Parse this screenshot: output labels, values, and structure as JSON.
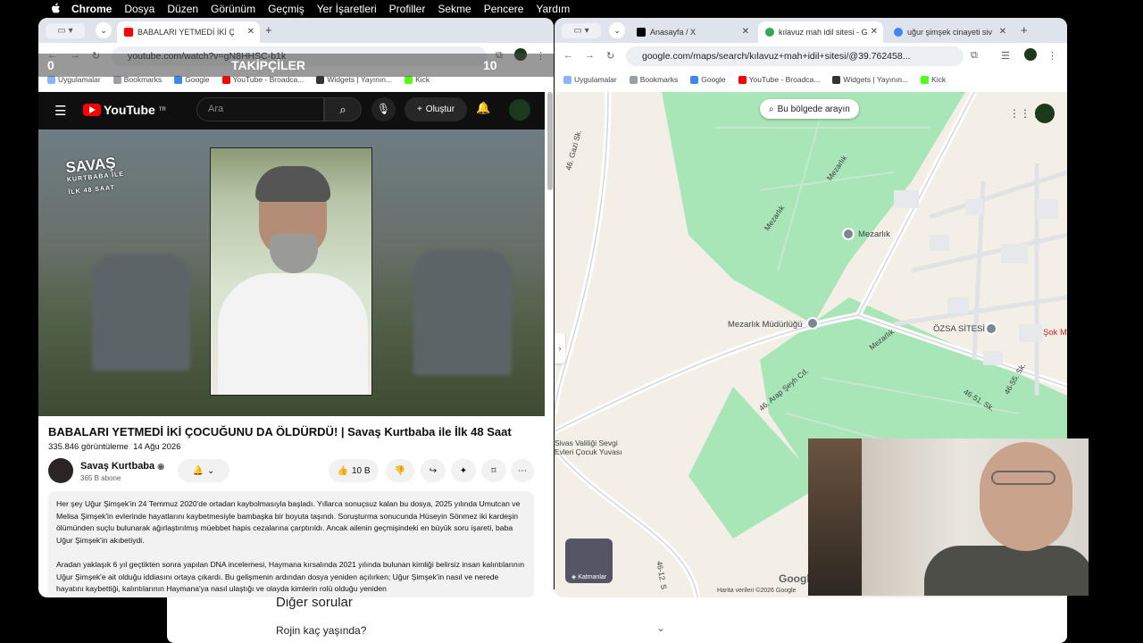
{
  "menubar": {
    "app": "Chrome",
    "items": [
      "Dosya",
      "Düzen",
      "Görünüm",
      "Geçmiş",
      "Yer İşaretleri",
      "Profiller",
      "Sekme",
      "Pencere",
      "Yardım"
    ]
  },
  "left_window": {
    "tab_title": "BABALARI YETMEDİ İKİ ÇOCUĞ",
    "url": "youtube.com/watch?v=gN8HHSC-b1k",
    "bookmarks": [
      "Uygulamalar",
      "Bookmarks",
      "Google",
      "YouTube - Broadca...",
      "Widgets | Yayının...",
      "Kick"
    ],
    "overlay": {
      "left": "0",
      "center": "TAKİPÇİLER",
      "right": "10"
    },
    "youtube": {
      "logo": "YouTube",
      "region": "TR",
      "search_placeholder": "Ara",
      "create": "Oluştur"
    },
    "video": {
      "logo_line1": "SAVAŞ",
      "logo_line2": "KURTBABA İLE",
      "logo_line3": "İLK 48 SAAT"
    },
    "title": "BABALARI YETMEDİ İKİ ÇOCUĞUNU DA ÖLDÜRDÜ! | Savaş Kurtbaba ile İlk 48 Saat",
    "views": "335.846 görüntüleme",
    "date": "14 Ağu 2026",
    "channel": "Savaş Kurtbaba",
    "subscribers": "365 B abone",
    "likes": "10 B",
    "description": [
      "Her şey Uğur Şimşek'in 24 Temmuz 2020'de ortadan kaybolmasıyla başladı. Yıllarca sonuçsuz kalan bu dosya, 2025 yılında Umutcan ve Melisa Şimşek'in evlerinde hayatlarını kaybetmesiyle bambaşka bir boyuta taşındı. Soruşturma sonucunda Hüseyin Sönmez iki kardeşin ölümünden suçlu bulunarak ağırlaştırılmış müebbet hapis cezalarına çarptırıldı. Ancak ailenin geçmişindeki en büyük soru işareti, baba Uğur Şimşek'in akıbetiydi.",
      "Aradan yaklaşık 6 yıl geçtikten sonra yapılan DNA incelemesi, Haymana kırsalında 2021 yılında bulunan kimliği belirsiz insan kalıntılarının Uğur Şimşek'e ait olduğu iddiasını ortaya çıkardı. Bu gelişmenin ardından dosya yeniden açılırken; Uğur Şimşek'in nasıl ve nerede hayatını kaybettiği, kalıntılarının Haymana'ya nasıl ulaştığı ve olayda kimlerin rolü olduğu yeniden"
    ]
  },
  "right_window": {
    "tabs": [
      "Anasayfa / X",
      "kılavuz mah idil sitesi - G",
      "uğur şimşek cinayeti siv"
    ],
    "url": "google.com/maps/search/kılavuz+mah+idil+sitesi/@39.762458...",
    "bookmarks": [
      "Uygulamalar",
      "Bookmarks",
      "Google",
      "YouTube - Broadca...",
      "Widgets | Yayının...",
      "Kick"
    ],
    "map": {
      "search_area": "Bu bölgede arayın",
      "places": [
        "Mezarlık",
        "Mezarlık Müdürlüğü",
        "ÖZSA SİTESİ",
        "Şok M",
        "Sivas Valiliği Sevgi Evleri Çocuk Yuvası"
      ],
      "roads": [
        "Mezarlık",
        "Mezarlık",
        "Mezarlık",
        "46. Arap Şeyh Cd.",
        "46-51. Sk.",
        "46-55. Sk.",
        "46-12. S",
        "46. Gazi Sk."
      ],
      "layers": "Katmanlar",
      "footer": "Harita verileri ©2026 Google",
      "google": "Google"
    }
  },
  "behind_window": {
    "heading": "Diğer sorular",
    "question": "Rojin kaç yaşında?"
  }
}
